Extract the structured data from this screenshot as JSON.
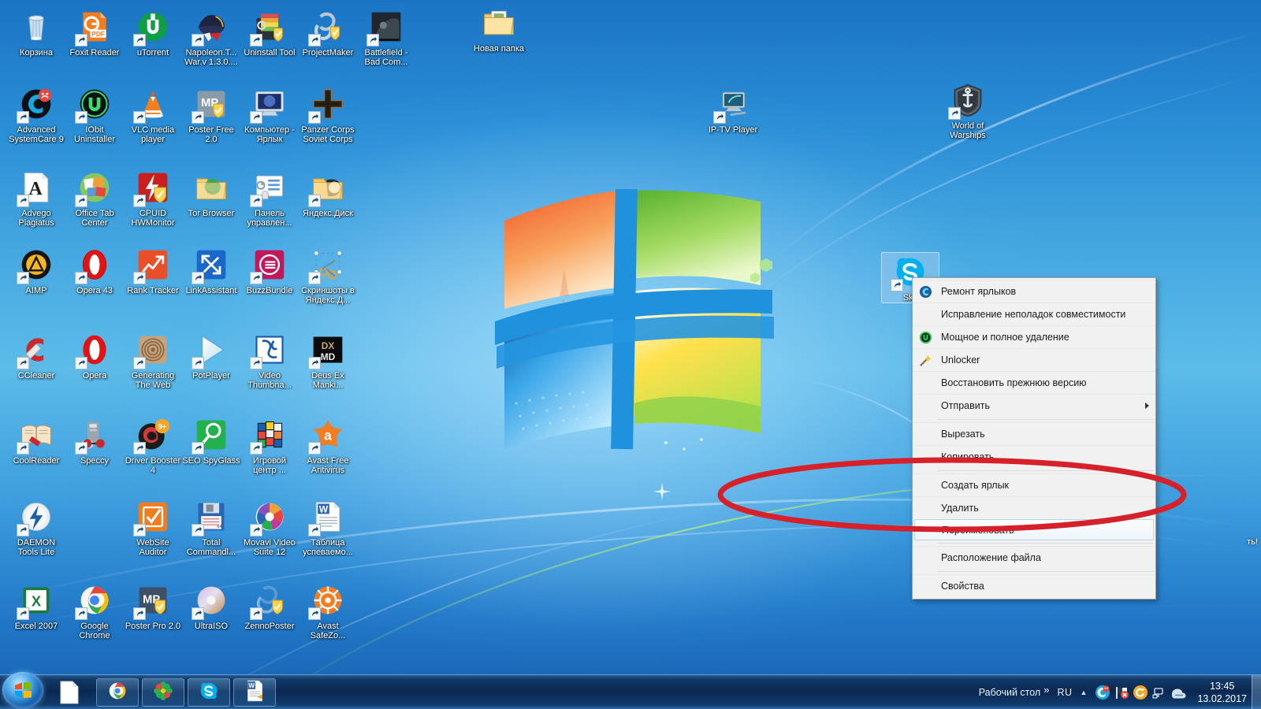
{
  "desktop": {
    "wallpaper": "windows-7-default-harmony",
    "background_colors": {
      "top": "#1b74c4",
      "mid": "#5cbbe8",
      "bottom": "#1761b0"
    },
    "icons": [
      {
        "label": "Корзина",
        "icon": "recycle-bin-icon",
        "col": 0,
        "row": 0,
        "shortcut": false
      },
      {
        "label": "Foxit Reader",
        "icon": "foxit-reader-icon",
        "col": 1,
        "row": 0,
        "shortcut": true
      },
      {
        "label": "uTorrent",
        "icon": "utorrent-icon",
        "col": 2,
        "row": 0,
        "shortcut": true
      },
      {
        "label": "Napoleon.T... War.v 1.3.0....",
        "icon": "napoleon-total-war-icon",
        "col": 3,
        "row": 0,
        "shortcut": true
      },
      {
        "label": "Uninstall Tool",
        "icon": "uninstall-tool-icon",
        "col": 4,
        "row": 0,
        "shortcut": true
      },
      {
        "label": "ProjectMaker",
        "icon": "projectmaker-icon",
        "col": 5,
        "row": 0,
        "shortcut": true
      },
      {
        "label": "Battlefield - Bad Com...",
        "icon": "battlefield-bad-company-icon",
        "col": 6,
        "row": 0,
        "shortcut": true
      },
      {
        "label": "Новая папка",
        "icon": "folder-icon",
        "col": 8,
        "row": 0,
        "shortcut": false
      },
      {
        "label": "Advanced SystemCare 9",
        "icon": "advanced-systemcare-icon",
        "col": 0,
        "row": 1,
        "shortcut": true
      },
      {
        "label": "IObit Uninstaller",
        "icon": "iobit-uninstaller-icon",
        "col": 1,
        "row": 1,
        "shortcut": true
      },
      {
        "label": "VLC media player",
        "icon": "vlc-media-player-icon",
        "col": 2,
        "row": 1,
        "shortcut": true
      },
      {
        "label": "Poster Free 2.0",
        "icon": "poster-free-icon",
        "col": 3,
        "row": 1,
        "shortcut": true
      },
      {
        "label": "Компьютер - Ярлык",
        "icon": "computer-icon",
        "col": 4,
        "row": 1,
        "shortcut": true
      },
      {
        "label": "Panzer Corps Soviet Corps",
        "icon": "panzer-corps-icon",
        "col": 5,
        "row": 1,
        "shortcut": true
      },
      {
        "label": "IP-TV Player",
        "icon": "ip-tv-player-icon",
        "col": 12,
        "row": 1,
        "shortcut": true
      },
      {
        "label": "World of Warships",
        "icon": "world-of-warships-icon",
        "col": 16,
        "row": 1,
        "shortcut": true
      },
      {
        "label": "Advego Plagiatus",
        "icon": "advego-plagiatus-icon",
        "col": 0,
        "row": 2,
        "shortcut": true
      },
      {
        "label": "Office Tab Center",
        "icon": "office-tab-center-icon",
        "col": 1,
        "row": 2,
        "shortcut": true
      },
      {
        "label": "CPUID HWMonitor",
        "icon": "cpuid-hwmonitor-icon",
        "col": 2,
        "row": 2,
        "shortcut": true
      },
      {
        "label": "Tor Browser",
        "icon": "tor-browser-icon",
        "col": 3,
        "row": 2,
        "shortcut": false
      },
      {
        "label": "Панель управлен...",
        "icon": "control-panel-icon",
        "col": 4,
        "row": 2,
        "shortcut": true
      },
      {
        "label": "Яндекс.Диск",
        "icon": "yandex-disk-icon",
        "col": 5,
        "row": 2,
        "shortcut": true
      },
      {
        "label": "AIMP",
        "icon": "aimp-icon",
        "col": 0,
        "row": 3,
        "shortcut": true
      },
      {
        "label": "Opera 43",
        "icon": "opera-43-icon",
        "col": 1,
        "row": 3,
        "shortcut": true
      },
      {
        "label": "Rank Tracker",
        "icon": "rank-tracker-icon",
        "col": 2,
        "row": 3,
        "shortcut": true
      },
      {
        "label": "LinkAssistant",
        "icon": "linkassistant-icon",
        "col": 3,
        "row": 3,
        "shortcut": true
      },
      {
        "label": "BuzzBundle",
        "icon": "buzzbundle-icon",
        "col": 4,
        "row": 3,
        "shortcut": true
      },
      {
        "label": "Скриншоты в Яндекс.Д...",
        "icon": "yandex-screenshots-icon",
        "col": 5,
        "row": 3,
        "shortcut": true
      },
      {
        "label": "CCleaner",
        "icon": "ccleaner-icon",
        "col": 0,
        "row": 4,
        "shortcut": true
      },
      {
        "label": "Opera",
        "icon": "opera-icon",
        "col": 1,
        "row": 4,
        "shortcut": true
      },
      {
        "label": "Generating The Web",
        "icon": "generating-the-web-icon",
        "col": 2,
        "row": 4,
        "shortcut": true
      },
      {
        "label": "PotPlayer",
        "icon": "potplayer-icon",
        "col": 3,
        "row": 4,
        "shortcut": true
      },
      {
        "label": "Video Thumbna...",
        "icon": "video-thumbnailer-icon",
        "col": 4,
        "row": 4,
        "shortcut": true
      },
      {
        "label": "Deus Ex Manki...",
        "icon": "deus-ex-mankind-divided-icon",
        "col": 5,
        "row": 4,
        "shortcut": true
      },
      {
        "label": "CoolReader",
        "icon": "coolreader-icon",
        "col": 0,
        "row": 5,
        "shortcut": true
      },
      {
        "label": "Speccy",
        "icon": "speccy-icon",
        "col": 1,
        "row": 5,
        "shortcut": true
      },
      {
        "label": "Driver Booster 4",
        "icon": "driver-booster-icon",
        "col": 2,
        "row": 5,
        "shortcut": true
      },
      {
        "label": "SEO SpyGlass",
        "icon": "seo-spyglass-icon",
        "col": 3,
        "row": 5,
        "shortcut": true
      },
      {
        "label": "Игровой центр ...",
        "icon": "game-center-icon",
        "col": 4,
        "row": 5,
        "shortcut": true
      },
      {
        "label": "Avast Free Antivirus",
        "icon": "avast-free-antivirus-icon",
        "col": 5,
        "row": 5,
        "shortcut": true
      },
      {
        "label": "Sky",
        "icon": "skype-icon",
        "col": 14,
        "row": 5,
        "shortcut": true,
        "selected": true
      },
      {
        "label": "DAEMON Tools Lite",
        "icon": "daemon-tools-lite-icon",
        "col": 0,
        "row": 6,
        "shortcut": true
      },
      {
        "label": "WebSite Auditor",
        "icon": "website-auditor-icon",
        "col": 2,
        "row": 6,
        "shortcut": true
      },
      {
        "label": "Total Commandl...",
        "icon": "total-commander-icon",
        "col": 3,
        "row": 6,
        "shortcut": true
      },
      {
        "label": "Movavi Video Suite 12",
        "icon": "movavi-video-suite-icon",
        "col": 4,
        "row": 6,
        "shortcut": true
      },
      {
        "label": "Таблица успеваемо...",
        "icon": "word-document-icon",
        "col": 5,
        "row": 6,
        "shortcut": true
      },
      {
        "label": "Excel 2007",
        "icon": "excel-2007-icon",
        "col": 0,
        "row": 7,
        "shortcut": true
      },
      {
        "label": "Google Chrome",
        "icon": "google-chrome-icon",
        "col": 1,
        "row": 7,
        "shortcut": true
      },
      {
        "label": "Poster Pro 2.0",
        "icon": "poster-pro-icon",
        "col": 2,
        "row": 7,
        "shortcut": true
      },
      {
        "label": "UltraISO",
        "icon": "ultraiso-icon",
        "col": 3,
        "row": 7,
        "shortcut": true
      },
      {
        "label": "ZennoPoster",
        "icon": "zennoposter-icon",
        "col": 4,
        "row": 7,
        "shortcut": true
      },
      {
        "label": "Avast SafeZo...",
        "icon": "avast-safezone-icon",
        "col": 5,
        "row": 7,
        "shortcut": true
      }
    ],
    "partial_right_label": "ть!"
  },
  "context_menu": {
    "items": [
      {
        "label": "Ремонт ярлыков",
        "icon": "glary-utilities-icon",
        "has_icon": true,
        "highlighted": false,
        "submenu": false
      },
      {
        "label": "Исправление неполадок совместимости",
        "icon": null,
        "has_icon": false,
        "highlighted": false,
        "submenu": false
      },
      {
        "label": "Мощное и полное удаление",
        "icon": "iobit-uninstaller-icon",
        "has_icon": true,
        "highlighted": false,
        "submenu": false
      },
      {
        "label": "Unlocker",
        "icon": "unlocker-wand-icon",
        "has_icon": true,
        "highlighted": false,
        "submenu": false
      },
      {
        "label": "Восстановить прежнюю версию",
        "icon": null,
        "has_icon": false,
        "highlighted": false,
        "submenu": false
      },
      {
        "label": "Отправить",
        "icon": null,
        "has_icon": false,
        "highlighted": false,
        "submenu": true
      },
      {
        "separator_after": true,
        "label": "",
        "icon": null,
        "has_icon": false,
        "highlighted": false,
        "submenu": false
      },
      {
        "label": "Вырезать",
        "icon": null,
        "has_icon": false,
        "highlighted": false,
        "submenu": false
      },
      {
        "label": "Копировать",
        "icon": null,
        "has_icon": false,
        "highlighted": false,
        "submenu": false
      },
      {
        "separator_after": true,
        "label": "",
        "icon": null,
        "has_icon": false,
        "highlighted": false,
        "submenu": false
      },
      {
        "label": "Создать ярлык",
        "icon": null,
        "has_icon": false,
        "highlighted": false,
        "submenu": false
      },
      {
        "label": "Удалить",
        "icon": null,
        "has_icon": false,
        "highlighted": false,
        "submenu": false
      },
      {
        "label": "Переименовать",
        "icon": null,
        "has_icon": false,
        "highlighted": true,
        "submenu": false
      },
      {
        "separator_after": true,
        "label": "",
        "icon": null,
        "has_icon": false,
        "highlighted": false,
        "submenu": false
      },
      {
        "label": "Расположение файла",
        "icon": null,
        "has_icon": false,
        "highlighted": false,
        "submenu": false
      },
      {
        "separator_after": true,
        "label": "",
        "icon": null,
        "has_icon": false,
        "highlighted": false,
        "submenu": false
      },
      {
        "label": "Свойства",
        "icon": null,
        "has_icon": false,
        "highlighted": false,
        "submenu": false
      }
    ]
  },
  "annotation": {
    "shape": "ellipse",
    "color": "#d6202a",
    "stroke_width": 7,
    "target_item": "Переименовать"
  },
  "taskbar": {
    "start_button": "start-orb-icon",
    "quick_launch": [
      {
        "name": "show-desktop-document-icon",
        "label": ""
      }
    ],
    "buttons": [
      {
        "name": "taskbar-button-chrome",
        "icon": "google-chrome-icon",
        "label": ""
      },
      {
        "name": "taskbar-button-icq",
        "icon": "icq-flower-icon",
        "label": ""
      },
      {
        "name": "taskbar-button-skype",
        "icon": "skype-icon",
        "label": ""
      },
      {
        "name": "taskbar-button-word",
        "icon": "microsoft-word-icon",
        "label": ""
      }
    ],
    "tray": {
      "desktop_toolbar_label": "Рабочий стол",
      "overflow_chevron": "»",
      "language": "RU",
      "show_hidden_icons": "▲",
      "icons": [
        {
          "name": "advanced-systemcare-tray-icon",
          "color": "#19a7dd"
        },
        {
          "name": "avast-flag-tray-icon",
          "color": "#e8453c"
        },
        {
          "name": "driver-booster-tray-icon",
          "color": "#f5a623"
        },
        {
          "name": "network-tray-icon",
          "color": "#d8e6f2"
        },
        {
          "name": "action-center-tray-icon",
          "color": "#c9dced"
        }
      ],
      "clock_time": "13:45",
      "clock_date": "13.02.2017",
      "show_desktop_button": "show-desktop-button"
    }
  }
}
